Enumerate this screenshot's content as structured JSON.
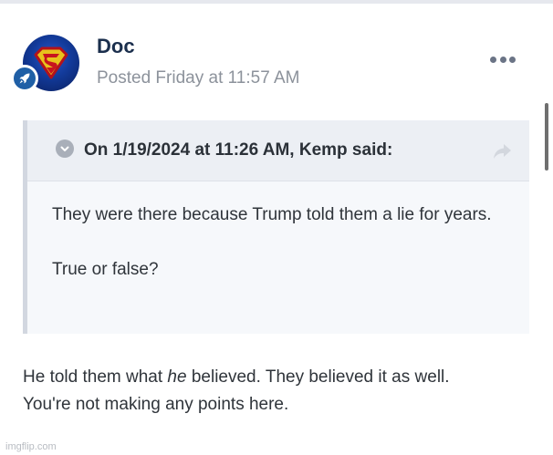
{
  "post": {
    "author": "Doc",
    "posted": "Posted Friday at 11:57 AM",
    "avatar_icon": "superman-logo-icon",
    "rank_icon": "rocket-icon",
    "options_icon": "more-options-icon"
  },
  "quote": {
    "citation": "On 1/19/2024 at 11:26 AM, Kemp said:",
    "lines": [
      "They were there because Trump told them a lie for years.",
      "True or false?"
    ],
    "collapse_icon": "chevron-down-icon",
    "share_icon": "share-arrow-icon"
  },
  "body": {
    "line1_before": "He told them what ",
    "line1_em": "he",
    "line1_after": " believed.  They believed it as well.",
    "line2": "You're not making any points here."
  },
  "watermark": "imgflip.com",
  "colors": {
    "author": "#1b2f4d",
    "meta": "#8c929b",
    "quote_bg": "#f6f8fb",
    "quote_header_bg": "#eceff4",
    "rank_badge": "#1f5fa6"
  }
}
